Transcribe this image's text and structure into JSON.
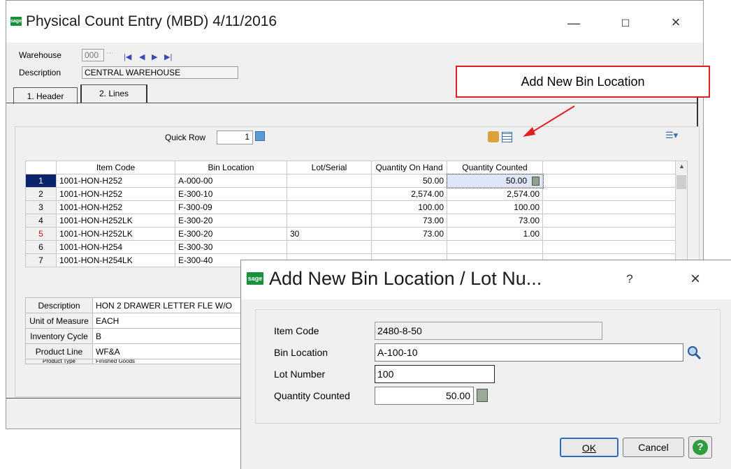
{
  "main": {
    "title": "Physical Count Entry (MBD) 4/11/2016",
    "logo": "sage",
    "warehouse_label": "Warehouse",
    "warehouse_value": "000",
    "description_label": "Description",
    "description_value": "CENTRAL WAREHOUSE",
    "tabs": [
      {
        "label": "1. Header"
      },
      {
        "label": "2. Lines"
      }
    ],
    "quick_row_label": "Quick Row",
    "quick_row_value": "1",
    "columns": [
      "Item Code",
      "Bin Location",
      "Lot/Serial",
      "Quantity On Hand",
      "Quantity Counted"
    ],
    "rows": [
      {
        "n": "1",
        "item": "1001-HON-H252",
        "bin": "A-000-00",
        "lot": "",
        "qoh": "50.00",
        "qc": "50.00"
      },
      {
        "n": "2",
        "item": "1001-HON-H252",
        "bin": "E-300-10",
        "lot": "",
        "qoh": "2,574.00",
        "qc": "2,574.00"
      },
      {
        "n": "3",
        "item": "1001-HON-H252",
        "bin": "F-300-09",
        "lot": "",
        "qoh": "100.00",
        "qc": "100.00"
      },
      {
        "n": "4",
        "item": "1001-HON-H252LK",
        "bin": "E-300-20",
        "lot": "",
        "qoh": "73.00",
        "qc": "73.00"
      },
      {
        "n": "5",
        "item": "1001-HON-H252LK",
        "bin": "E-300-20",
        "lot": "30",
        "qoh": "73.00",
        "qc": "1.00"
      },
      {
        "n": "6",
        "item": "1001-HON-H254",
        "bin": "E-300-30",
        "lot": "",
        "qoh": "",
        "qc": ""
      },
      {
        "n": "7",
        "item": "1001-HON-H254LK",
        "bin": "E-300-40",
        "lot": "",
        "qoh": "",
        "qc": ""
      }
    ],
    "info": [
      {
        "k": "Description",
        "v": "HON 2 DRAWER LETTER FLE W/O"
      },
      {
        "k": "Unit of Measure",
        "v": "EACH"
      },
      {
        "k": "Inventory Cycle",
        "v": "B"
      },
      {
        "k": "Product Line",
        "v": "WF&A"
      },
      {
        "k": "Product Type",
        "v": "Finished Goods"
      }
    ],
    "colors": {
      "selected_row": "#0a246a",
      "row5_number": "#d01010"
    }
  },
  "callout": {
    "text": "Add New Bin Location",
    "color": "#e02020"
  },
  "dialog": {
    "title": "Add New Bin Location / Lot Nu...",
    "help": "?",
    "close": "×",
    "item_code_label": "Item Code",
    "item_code_value": "2480-8-50",
    "bin_label": "Bin Location",
    "bin_value": "A-100-10",
    "lot_label": "Lot Number",
    "lot_value": "100",
    "qty_label": "Quantity Counted",
    "qty_value": "50.00",
    "ok": "OK",
    "cancel": "Cancel"
  },
  "window_controls": {
    "min": "—",
    "max": "☐",
    "close": "×"
  }
}
